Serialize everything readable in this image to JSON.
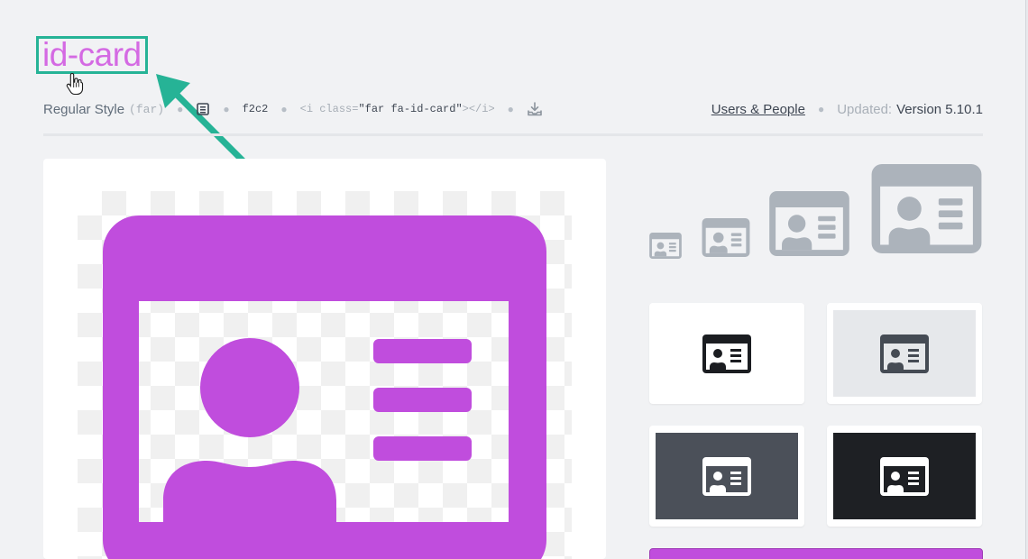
{
  "icon": {
    "name": "id-card",
    "style_label": "Regular Style",
    "style_prefix": "(far)",
    "unicode": "f2c2",
    "code_open": "<i class=",
    "code_class": "\"far fa-id-card\"",
    "code_close": "></i>",
    "category": "Users & People",
    "updated_label": "Updated:",
    "updated_value": "Version 5.10.1"
  },
  "colors": {
    "accent": "#c04ddd",
    "annotation": "#26b396",
    "size_preview": "#acb3bb"
  },
  "tiles": [
    {
      "bg": "#ffffff",
      "icon": "#1b1d21"
    },
    {
      "bg": "#e6e8eb",
      "icon": "#454b54"
    },
    {
      "bg": "#4b5059",
      "icon": "#ffffff"
    },
    {
      "bg": "#1e2024",
      "icon": "#ffffff"
    }
  ]
}
